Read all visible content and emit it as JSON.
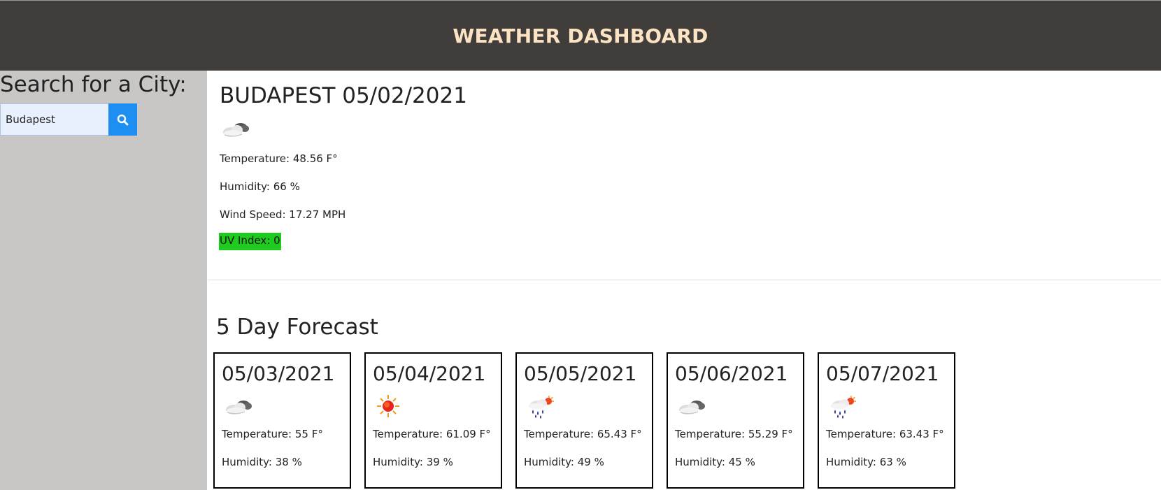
{
  "header": {
    "title": "WEATHER DASHBOARD"
  },
  "sidebar": {
    "title": "Search for a City:",
    "search_value": "Budapest",
    "search_icon": "search-icon"
  },
  "current": {
    "title": "BUDAPEST 05/02/2021",
    "icon": "partly-cloudy-icon",
    "temperature": "Temperature: 48.56 F°",
    "humidity": "Humidity: 66 %",
    "wind": "Wind Speed: 17.27 MPH",
    "uv": "UV Index: 0",
    "uv_color": "#1fcb1f"
  },
  "forecast": {
    "title": "5 Day Forecast",
    "days": [
      {
        "date": "05/03/2021",
        "icon": "partly-cloudy-icon",
        "temperature": "Temperature: 55 F°",
        "humidity": "Humidity: 38 %"
      },
      {
        "date": "05/04/2021",
        "icon": "sun-icon",
        "temperature": "Temperature: 61.09 F°",
        "humidity": "Humidity: 39 %"
      },
      {
        "date": "05/05/2021",
        "icon": "rain-sun-icon",
        "temperature": "Temperature: 65.43 F°",
        "humidity": "Humidity: 49 %"
      },
      {
        "date": "05/06/2021",
        "icon": "partly-cloudy-icon",
        "temperature": "Temperature: 55.29 F°",
        "humidity": "Humidity: 45 %"
      },
      {
        "date": "05/07/2021",
        "icon": "rain-sun-icon",
        "temperature": "Temperature: 63.43 F°",
        "humidity": "Humidity: 63 %"
      }
    ]
  },
  "colors": {
    "header_bg": "#403d3a",
    "header_text": "#fbe3c4",
    "sidebar_bg": "#c8c7c6",
    "accent": "#1e8ff2"
  }
}
